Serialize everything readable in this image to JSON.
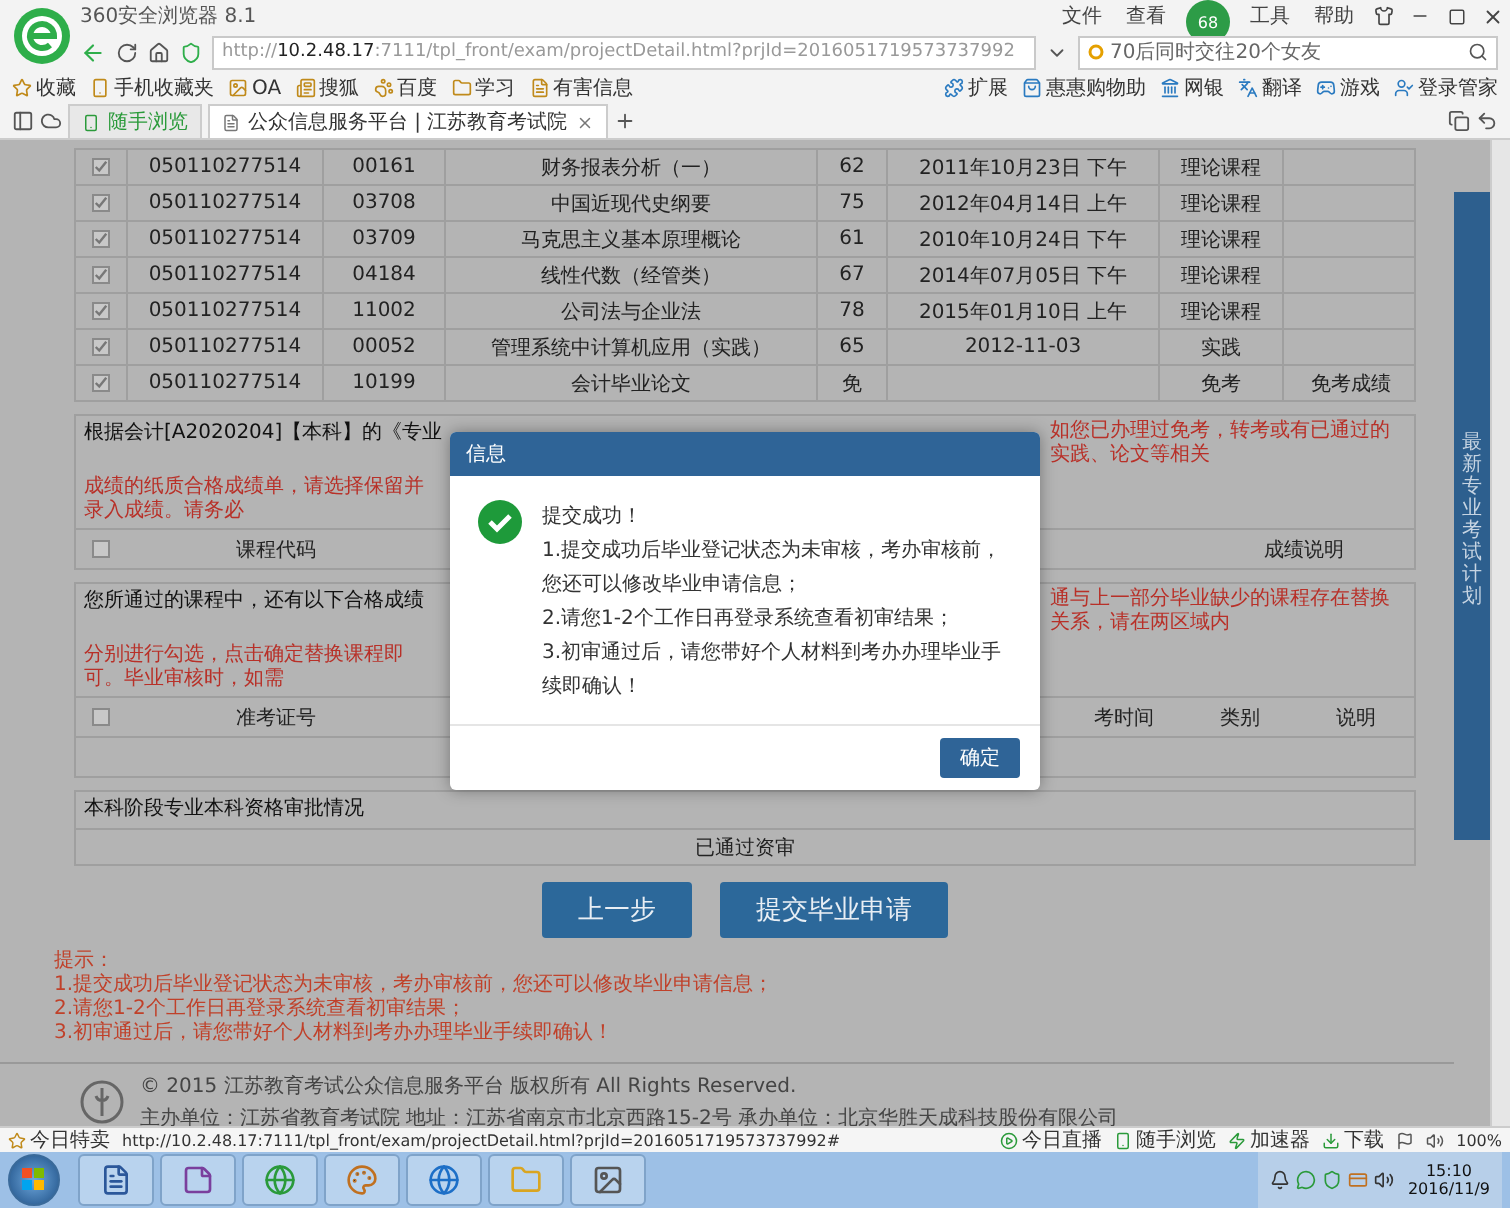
{
  "browser": {
    "title": "360安全浏览器 8.1",
    "menu": [
      {
        "kind": "text",
        "label": "文件"
      },
      {
        "kind": "text",
        "label": "查看"
      },
      {
        "kind": "badge",
        "label": "68"
      },
      {
        "kind": "text",
        "label": "工具"
      },
      {
        "kind": "text",
        "label": "帮助"
      }
    ],
    "url": "http://**10.2.48.17**:7111/tpl_front/exam/projectDetail.html?prjId=2016051719573737992",
    "search": {
      "value": "70后同时交往20个女友"
    },
    "bookmarks": [
      "收藏",
      "手机收藏夹",
      "OA",
      "搜狐",
      "百度",
      "学习",
      "有害信息"
    ],
    "tools": [
      "扩展",
      "惠惠购物助",
      "网银",
      "翻译",
      "游戏",
      "登录管家"
    ],
    "tabs": [
      {
        "label": "随手浏览",
        "selected": false
      },
      {
        "label": "公众信息服务平台 | 江苏教育考试院",
        "selected": true
      }
    ]
  },
  "table": {
    "rows": [
      {
        "checked": true,
        "exam_no": "050110277514",
        "code": "00161",
        "name": "财务报表分析（一）",
        "score": "62",
        "date": "2011年10月23日 下午",
        "type": "理论课程"
      },
      {
        "checked": true,
        "exam_no": "050110277514",
        "code": "03708",
        "name": "中国近现代史纲要",
        "score": "75",
        "date": "2012年04月14日 上午",
        "type": "理论课程"
      },
      {
        "checked": true,
        "exam_no": "050110277514",
        "code": "03709",
        "name": "马克思主义基本原理概论",
        "score": "61",
        "date": "2010年10月24日 下午",
        "type": "理论课程"
      },
      {
        "checked": true,
        "exam_no": "050110277514",
        "code": "04184",
        "name": "线性代数（经管类）",
        "score": "67",
        "date": "2014年07月05日 下午",
        "type": "理论课程"
      },
      {
        "checked": true,
        "exam_no": "050110277514",
        "code": "11002",
        "name": "公司法与企业法",
        "score": "78",
        "date": "2015年01月10日 上午",
        "type": "理论课程"
      },
      {
        "checked": true,
        "exam_no": "050110277514",
        "code": "00052",
        "name": "管理系统中计算机应用（实践）",
        "score": "65",
        "date": "2012-11-03",
        "type": "实践"
      },
      {
        "checked": true,
        "exam_no": "050110277514",
        "code": "10199",
        "name": "会计毕业论文",
        "score": "免",
        "type": "免考",
        "note": "免考成绩"
      }
    ]
  },
  "section_1": {
    "title": "根据会计[A2020204]【本科】的《专业",
    "notice_right": "如您已办理过免考，转考或有已通过的实践、论文等相关",
    "notice_left": "成绩的纸质合格成绩单，请选择保留并录入成绩。请务必",
    "checked": false,
    "header_left": [
      "课程代码"
    ],
    "header_right": [
      "成绩说明"
    ]
  },
  "section_2": {
    "title": "您所通过的课程中，还有以下合格成绩",
    "notice_right": "通与上一部分毕业缺少的课程存在替换关系，请在两区域内",
    "notice_left": "分别进行勾选，点击确定替换课程即可。毕业审核时，如需",
    "checked": false,
    "header_left": [
      "准考证号"
    ],
    "header_right": [
      "考时间",
      "类别",
      "说明"
    ]
  },
  "section_3": {
    "title": "本科阶段专业本科资格审批情况",
    "value": "已通过资审"
  },
  "buttons": [
    "上一步",
    "提交毕业申请"
  ],
  "tips": [
    "提示：",
    "1.提交成功后毕业登记状态为未审核，考办审核前，您还可以修改毕业申请信息；",
    "2.请您1-2个工作日再登录系统查看初审结果；",
    "3.初审通过后，请您带好个人材料到考办办理毕业手续即确认！"
  ],
  "footer": [
    "© 2015 江苏教育考试公众信息服务平台 版权所有 All Rights Reserved.",
    "主办单位：江苏省教育考试院 地址：江苏省南京市北京西路15-2号 承办单位：北京华胜天成科技股份有限公司"
  ],
  "side_tab": "最新专业考试计划",
  "dialog": {
    "title": "信息",
    "lines": [
      "提交成功！",
      "1.提交成功后毕业登记状态为未审核，考办审核前，您还可以修改毕业申请信息；",
      "2.请您1-2个工作日再登录系统查看初审结果；",
      "3.初审通过后，请您带好个人材料到考办办理毕业手续即确认！"
    ],
    "button": "确定"
  },
  "status_bar": {
    "left": "今日特卖",
    "url": "http://10.2.48.17:7111/tpl_front/exam/projectDetail.html?prjId=2016051719573737992#",
    "items": [
      "今日直播",
      "随手浏览",
      "加速器",
      "下载"
    ],
    "zoom": "100%"
  },
  "taskbar": {
    "time": "15:10",
    "date": "2016/11/9"
  }
}
